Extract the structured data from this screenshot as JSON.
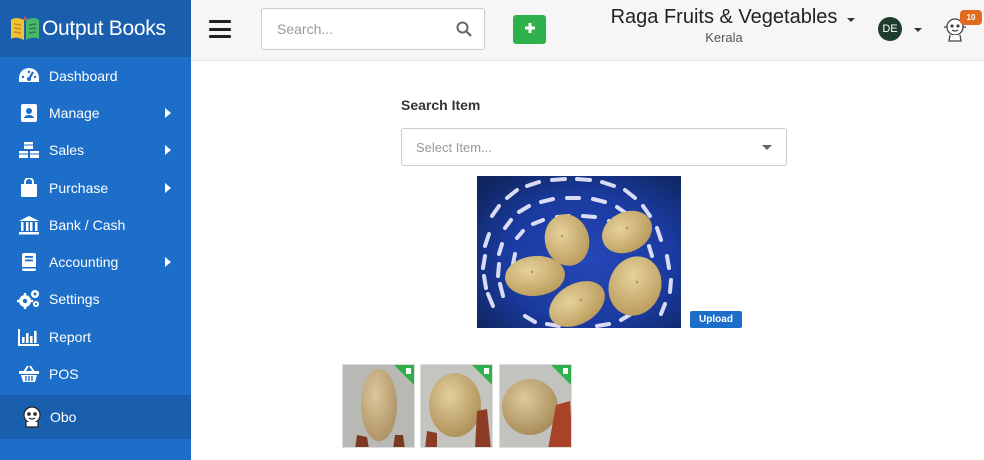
{
  "brand": {
    "name": "Output Books"
  },
  "sidebar": {
    "items": [
      {
        "label": "Dashboard",
        "icon": "dashboard-icon",
        "has_submenu": false
      },
      {
        "label": "Manage",
        "icon": "address-book-icon",
        "has_submenu": true
      },
      {
        "label": "Sales",
        "icon": "cubes-icon",
        "has_submenu": true
      },
      {
        "label": "Purchase",
        "icon": "shopping-bag-icon",
        "has_submenu": true
      },
      {
        "label": "Bank / Cash",
        "icon": "bank-icon",
        "has_submenu": false
      },
      {
        "label": "Accounting",
        "icon": "book-icon",
        "has_submenu": true
      },
      {
        "label": "Settings",
        "icon": "cogs-icon",
        "has_submenu": false
      },
      {
        "label": "Report",
        "icon": "bar-chart-icon",
        "has_submenu": false
      },
      {
        "label": "POS",
        "icon": "basket-icon",
        "has_submenu": false
      },
      {
        "label": "Obo",
        "icon": "robot-icon",
        "has_submenu": false
      }
    ]
  },
  "topbar": {
    "search_placeholder": "Search...",
    "company_name": "Raga Fruits & Vegetables",
    "company_location": "Kerala",
    "user_initials": "DE",
    "notification_count": "10"
  },
  "main": {
    "search_item_label": "Search Item",
    "select_placeholder": "Select Item...",
    "upload_label": "Upload",
    "thumbnails": [
      "potato-thumbnail-1",
      "potato-thumbnail-2",
      "potato-thumbnail-3"
    ]
  },
  "colors": {
    "sidebar": "#1d6ec9",
    "sidebar_dark": "#1a5fad",
    "add_button": "#2eb04a",
    "badge": "#e06a1e",
    "upload_button": "#1d6ec9"
  }
}
